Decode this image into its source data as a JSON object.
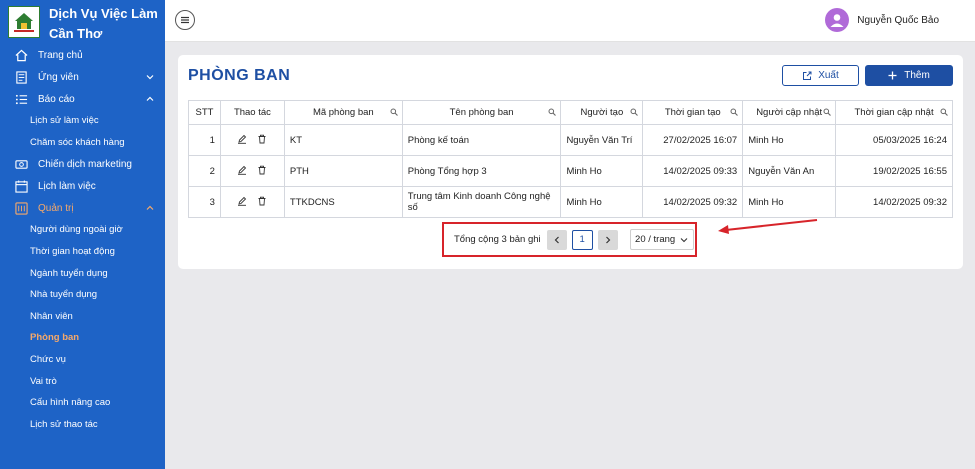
{
  "brand": {
    "name": "Dịch Vụ Việc Làm Cần Thơ"
  },
  "sidebar": {
    "items": [
      {
        "label": "Trang chủ",
        "icon": "home-icon"
      },
      {
        "label": "Ứng viên",
        "icon": "candidate-icon"
      },
      {
        "label": "Báo cáo",
        "icon": "list-icon"
      },
      {
        "label": "Lịch sử làm việc"
      },
      {
        "label": "Chăm sóc khách hàng"
      },
      {
        "label": "Chiến dịch marketing",
        "icon": "campaign-icon"
      },
      {
        "label": "Lịch làm việc",
        "icon": "calendar-icon"
      },
      {
        "label": "Quản trị",
        "icon": "admin-icon"
      },
      {
        "label": "Người dùng ngoài giờ"
      },
      {
        "label": "Thời gian hoạt động"
      },
      {
        "label": "Ngành tuyển dụng"
      },
      {
        "label": "Nhà tuyển dụng"
      },
      {
        "label": "Nhân viên"
      },
      {
        "label": "Phòng ban"
      },
      {
        "label": "Chức vụ"
      },
      {
        "label": "Vai trò"
      },
      {
        "label": "Cấu hình nâng cao"
      },
      {
        "label": "Lịch sử thao tác"
      }
    ],
    "active_color": "#f6a96a",
    "bg_color": "#1e63c6"
  },
  "header": {
    "username": "Nguyễn Quốc Bảo"
  },
  "page": {
    "title": "PHÒNG BAN",
    "export_label": "Xuất",
    "add_label": "Thêm"
  },
  "table": {
    "columns": [
      "STT",
      "Thao tác",
      "Mã phòng ban",
      "Tên phòng ban",
      "Người tạo",
      "Thời gian tạo",
      "Người cập nhật",
      "Thời gian cập nhật"
    ],
    "rows": [
      [
        "1",
        "",
        "KT",
        "Phòng kế toán",
        "Nguyễn Văn Trí",
        "27/02/2025 16:07",
        "Minh Ho",
        "05/03/2025 16:24"
      ],
      [
        "2",
        "",
        "PTH",
        "Phòng Tổng hợp 3",
        "Minh Ho",
        "14/02/2025 09:33",
        "Nguyễn Văn An",
        "19/02/2025 16:55"
      ],
      [
        "3",
        "",
        "TTKDCNS",
        "Trung tâm Kinh doanh Công nghệ số",
        "Minh Ho",
        "14/02/2025 09:32",
        "Minh Ho",
        "14/02/2025 09:32"
      ]
    ]
  },
  "pagination": {
    "total_text": "Tổng cộng 3 bản ghi",
    "current_page": "1",
    "page_size": "20 / trang"
  },
  "colors": {
    "primary": "#1e4fa3",
    "highlight": "#d7242a"
  }
}
